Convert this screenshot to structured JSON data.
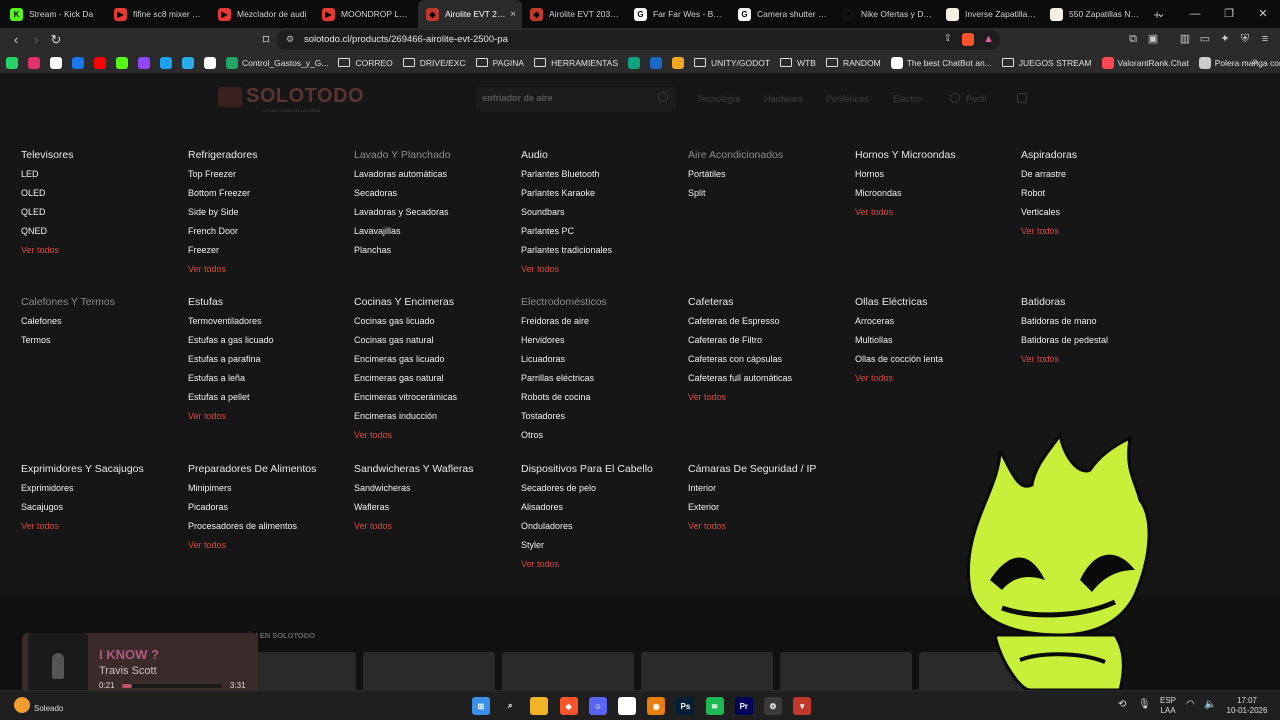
{
  "browser": {
    "tabs": [
      {
        "label": "Stream - Kick Da",
        "color": "#53fc18",
        "glyph": "K"
      },
      {
        "label": "fifine sc8 mixer – Co",
        "color": "#e53935",
        "glyph": "▶"
      },
      {
        "label": "Mezclador de audi",
        "color": "#e53935",
        "glyph": "▶"
      },
      {
        "label": "MOONDROP LAN II",
        "color": "#e53935",
        "glyph": "▶"
      },
      {
        "label": "Airolite EVT 250",
        "color": "#c0392b",
        "glyph": "◆",
        "active": true
      },
      {
        "label": "Airolite EVT 2031 Sl",
        "color": "#c0392b",
        "glyph": "◆"
      },
      {
        "label": "Far Far Wes - Busca",
        "color": "#ffffff",
        "glyph": "G"
      },
      {
        "label": "Camera shutter and",
        "color": "#ffffff",
        "glyph": "G"
      },
      {
        "label": "Nike Ofertas y Desc",
        "color": "#111111",
        "glyph": "✓"
      },
      {
        "label": "Inverse Zapatillas Pr",
        "color": "#f4efe0",
        "glyph": ""
      },
      {
        "label": "550 Zapatillas New",
        "color": "#f4efe0",
        "glyph": ""
      }
    ],
    "close_glyph": "×",
    "new_tab_glyph": "+",
    "url": "solotodo.cl/products/269466-airolite-evt-2500-pa",
    "bookmarks": [
      {
        "label": "",
        "color": "#25d366"
      },
      {
        "label": "",
        "color": "#e1306c"
      },
      {
        "label": "",
        "color": "#ffffff"
      },
      {
        "label": "",
        "color": "#1877f2"
      },
      {
        "label": "",
        "color": "#ff0000"
      },
      {
        "label": "",
        "color": "#53fc18"
      },
      {
        "label": "",
        "color": "#9146ff"
      },
      {
        "label": "",
        "color": "#1da1f2"
      },
      {
        "label": "",
        "color": "#2aabee"
      },
      {
        "label": "",
        "color": "#ffffff"
      },
      {
        "label": "Control_Gastos_y_G...",
        "color": "#23a566"
      },
      {
        "label": "CORREO",
        "folder": true
      },
      {
        "label": "DRIVE/EXC",
        "folder": true
      },
      {
        "label": "PAGINA",
        "folder": true
      },
      {
        "label": "HERRAMIENTAS",
        "folder": true
      },
      {
        "label": "",
        "color": "#10a37f"
      },
      {
        "label": "",
        "color": "#1b6ac9"
      },
      {
        "label": "",
        "color": "#f5a623"
      },
      {
        "label": "UNITY/GODOT",
        "folder": true
      },
      {
        "label": "WTB",
        "folder": true
      },
      {
        "label": "RANDOM",
        "folder": true
      },
      {
        "label": "The best ChatBot an...",
        "color": "#ffffff"
      },
      {
        "label": "JUEGOS STREAM",
        "folder": true
      },
      {
        "label": "ValorantRank.Chat",
        "color": "#ff4655"
      },
      {
        "label": "Polera manga corta...",
        "color": "#cccccc"
      }
    ]
  },
  "site": {
    "logo_text": "SOLOTODO",
    "logo_sub": "COTIZA • COMPARA • AHORRA",
    "search_placeholder": "enfriador de aire",
    "nav": [
      "Tecnología",
      "Hardware",
      "Periféricos",
      "Electro",
      "Perfil"
    ]
  },
  "megamenu": {
    "view_all": "Ver todos",
    "categories": [
      {
        "title": "Televisores",
        "items": [
          "LED",
          "OLED",
          "QLED",
          "QNED"
        ],
        "view_all": true
      },
      {
        "title": "Refrigeradores",
        "items": [
          "Top Freezer",
          "Bottom Freezer",
          "Side by Side",
          "French Door",
          "Freezer"
        ],
        "view_all": true
      },
      {
        "title": "Lavado Y Planchado",
        "dim": true,
        "items": [
          "Lavadoras automáticas",
          "Secadoras",
          "Lavadoras y Secadoras",
          "Lavavajillas",
          "Planchas"
        ],
        "view_all": false
      },
      {
        "title": "Audio",
        "items": [
          "Parlantes Bluetooth",
          "Parlantes Karaoke",
          "Soundbars",
          "Parlantes PC",
          "Parlantes tradicionales"
        ],
        "view_all": true
      },
      {
        "title": "Aire Acondicionados",
        "dim": true,
        "items": [
          "Portátiles",
          "Split"
        ],
        "view_all": false
      },
      {
        "title": "Hornos Y Microondas",
        "items": [
          "Hornos",
          "Microondas"
        ],
        "view_all": true
      },
      {
        "title": "Aspiradoras",
        "items": [
          "De arrastre",
          "Robot",
          "Verticales"
        ],
        "view_all": true
      },
      {
        "title": "Calefones Y Termos",
        "dim": true,
        "items": [
          "Calefones",
          "Termos"
        ],
        "view_all": false
      },
      {
        "title": "Estufas",
        "items": [
          "Termoventiladores",
          "Estufas a gas licuado",
          "Estufas a parafina",
          "Estufas a leña",
          "Estufas a pellet"
        ],
        "view_all": true
      },
      {
        "title": "Cocinas Y Encimeras",
        "items": [
          "Cocinas gas licuado",
          "Cocinas gas natural",
          "Encimeras gas licuado",
          "Encimeras gas natural",
          "Encimeras vitrocerámicas",
          "Encimeras inducción"
        ],
        "view_all": true
      },
      {
        "title": "Electrodomésticos",
        "dim": true,
        "items": [
          "Freidoras de aire",
          "Hervidores",
          "Licuadoras",
          "Parrillas eléctricas",
          "Robots de cocina",
          "Tostadores",
          "Otros"
        ],
        "view_all": false
      },
      {
        "title": "Cafeteras",
        "items": [
          "Cafeteras de Espresso",
          "Cafeteras de Filtro",
          "Cafeteras con cápsulas",
          "Cafeteras full automáticas"
        ],
        "view_all": true
      },
      {
        "title": "Ollas Eléctricas",
        "items": [
          "Arroceras",
          "Multiollas",
          "Ollas de cocción lenta"
        ],
        "view_all": true
      },
      {
        "title": "Batidoras",
        "items": [
          "Batidoras de mano",
          "Batidoras de pedestal"
        ],
        "view_all": true
      },
      {
        "title": "Exprimidores Y Sacajugos",
        "items": [
          "Exprimidores",
          "Sacajugos"
        ],
        "view_all": true
      },
      {
        "title": "Preparadores De Alimentos",
        "items": [
          "Minipimers",
          "Picadoras",
          "Procesadores de alimentos"
        ],
        "view_all": true
      },
      {
        "title": "Sandwicheras Y Wafleras",
        "items": [
          "Sandwicheras",
          "Wafleras"
        ],
        "view_all": true
      },
      {
        "title": "Dispositivos Para El Cabello",
        "items": [
          "Secadores de pelo",
          "Alisadores",
          "Onduladores",
          "Styler"
        ],
        "view_all": true
      },
      {
        "title": "Cámaras De Seguridad / IP",
        "items": [
          "Interior",
          "Exterior"
        ],
        "view_all": true
      }
    ]
  },
  "footer": {
    "tambien": "TAMBIÉN EN SOLOTODO"
  },
  "music": {
    "song": "I KNOW ?",
    "artist": "Travis Scott",
    "current": "0:21",
    "total": "3:31",
    "progress": 0.1
  },
  "taskbar": {
    "weather": "Soleado",
    "lang_top": "ESP",
    "lang_bottom": "LAA",
    "time": "17:07",
    "date": "10-01-2026",
    "apps": [
      {
        "name": "start-icon",
        "color": "#3b8fe6",
        "glyph": "⊞"
      },
      {
        "name": "search-icon",
        "color": "transparent",
        "glyph": "⌕"
      },
      {
        "name": "file-explorer-icon",
        "color": "#f0b429",
        "glyph": ""
      },
      {
        "name": "brave-icon",
        "color": "#fb542b",
        "glyph": "◆"
      },
      {
        "name": "discord-icon",
        "color": "#5865f2",
        "glyph": "☺"
      },
      {
        "name": "notion-icon",
        "color": "#ffffff",
        "glyph": "N"
      },
      {
        "name": "blender-icon",
        "color": "#e87d0d",
        "glyph": "◉"
      },
      {
        "name": "photoshop-icon",
        "color": "#001e36",
        "glyph": "Ps"
      },
      {
        "name": "spotify-icon",
        "color": "#1db954",
        "glyph": "≋"
      },
      {
        "name": "premiere-icon",
        "color": "#00005b",
        "glyph": "Pr"
      },
      {
        "name": "steam-icon",
        "color": "#3a3a3a",
        "glyph": "⚙"
      },
      {
        "name": "app-icon",
        "color": "#c0392b",
        "glyph": "▼"
      }
    ]
  },
  "colors": {
    "accent": "#d8493b",
    "mascot": "#c8f03a"
  }
}
